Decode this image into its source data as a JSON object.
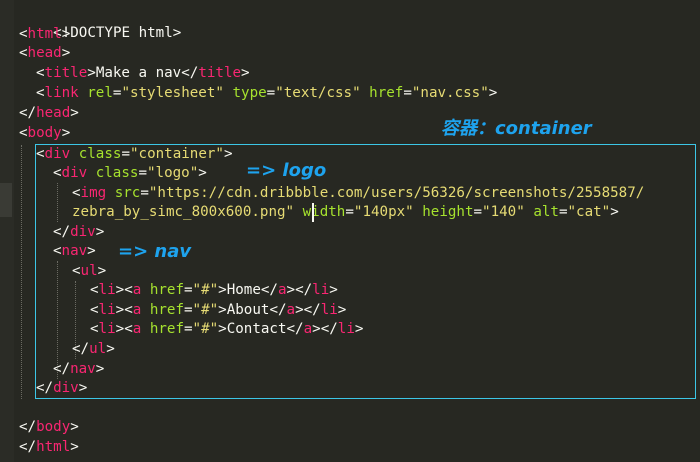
{
  "code": {
    "l1": {
      "text": "<!DOCTYPE html>"
    },
    "l2": {
      "open": "<",
      "tag": "html",
      "close": ">"
    },
    "l3": {
      "open": "<",
      "tag": "head",
      "close": ">"
    },
    "l4": {
      "t_open": "<",
      "t_tag": "title",
      "t_gt": ">",
      "text": "Make a nav",
      "c_open": "</",
      "c_tag": "title",
      "c_gt": ">"
    },
    "l5": {
      "open": "<",
      "tag": "link",
      "a1": "rel",
      "eq1": "=",
      "v1": "\"stylesheet\"",
      "a2": "type",
      "eq2": "=",
      "v2": "\"text/css\"",
      "a3": "href",
      "eq3": "=",
      "v3": "\"nav.css\"",
      "close": ">"
    },
    "l6": {
      "open": "</",
      "tag": "head",
      "close": ">"
    },
    "l7": {
      "open": "<",
      "tag": "body",
      "close": ">"
    },
    "l8": {
      "open": "<",
      "tag": "div",
      "a1": "class",
      "eq1": "=",
      "v1": "\"container\"",
      "close": ">"
    },
    "l9": {
      "open": "<",
      "tag": "div",
      "a1": "class",
      "eq1": "=",
      "v1": "\"logo\"",
      "close": ">"
    },
    "l10": {
      "open": "<",
      "tag": "img",
      "a1": "src",
      "eq1": "=",
      "v1": "\"https://cdn.dribbble.com/users/56326/screenshots/2558587/"
    },
    "l11": {
      "v1": "zebra_by_simc_800x600.png\"",
      "a2": "width",
      "eq2": "=",
      "v2": "\"140px\"",
      "a3": "height",
      "eq3": "=",
      "v3": "\"140\"",
      "a4": "alt",
      "eq4": "=",
      "v4": "\"cat\"",
      "close": ">"
    },
    "l12": {
      "open": "</",
      "tag": "div",
      "close": ">"
    },
    "l13": {
      "open": "<",
      "tag": "nav",
      "close": ">"
    },
    "l14": {
      "open": "<",
      "tag": "ul",
      "close": ">"
    },
    "items": [
      {
        "li_o": "<",
        "li": "li",
        "gt1": ">",
        "a_o": "<",
        "a": "a",
        "href": "href",
        "eq": "=",
        "hv": "\"#\"",
        "gt2": ">",
        "label": "Home",
        "a_c": "</",
        "a2": "a",
        "gt3": "></",
        "li2": "li",
        "gt4": ">"
      },
      {
        "li_o": "<",
        "li": "li",
        "gt1": ">",
        "a_o": "<",
        "a": "a",
        "href": "href",
        "eq": "=",
        "hv": "\"#\"",
        "gt2": ">",
        "label": "About",
        "a_c": "</",
        "a2": "a",
        "gt3": "></",
        "li2": "li",
        "gt4": ">"
      },
      {
        "li_o": "<",
        "li": "li",
        "gt1": ">",
        "a_o": "<",
        "a": "a",
        "href": "href",
        "eq": "=",
        "hv": "\"#\"",
        "gt2": ">",
        "label": "Contact",
        "a_c": "</",
        "a2": "a",
        "gt3": "></",
        "li2": "li",
        "gt4": ">"
      }
    ],
    "l18": {
      "open": "</",
      "tag": "ul",
      "close": ">"
    },
    "l19": {
      "open": "</",
      "tag": "nav",
      "close": ">"
    },
    "l20": {
      "open": "</",
      "tag": "div",
      "close": ">"
    },
    "l22": {
      "open": "</",
      "tag": "body",
      "close": ">"
    },
    "l23": {
      "open": "</",
      "tag": "html",
      "close": ">"
    }
  },
  "annotations": {
    "container": "容器：container",
    "logo": "=> logo",
    "nav": "=> nav"
  },
  "colors": {
    "background": "#272822",
    "tag": "#f92672",
    "attribute": "#a6e22e",
    "string": "#e6db74",
    "text": "#f8f8f2",
    "annotation": "#1ea3ee",
    "highlight_border": "#3cc6e6"
  }
}
